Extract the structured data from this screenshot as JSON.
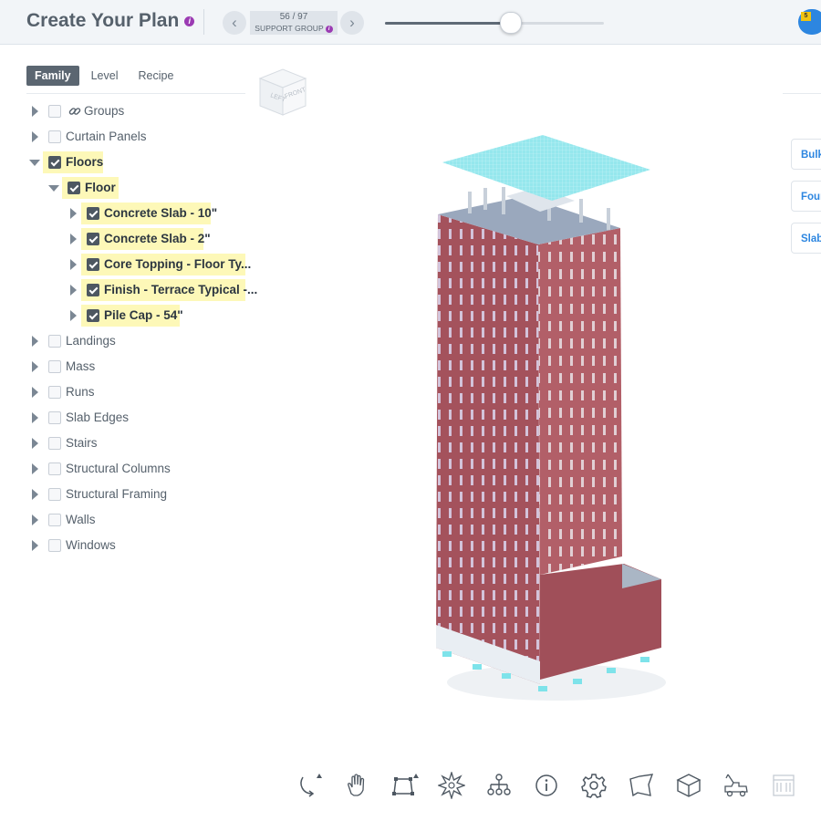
{
  "header": {
    "title": "Create Your Plan",
    "info_glyph": "i",
    "prev_glyph": "‹",
    "next_glyph": "›",
    "counter": "56 / 97",
    "group_label": "SUPPORT GROUP",
    "slider_percent": 57,
    "notification_count": "5"
  },
  "tabs": [
    {
      "label": "Family",
      "active": true
    },
    {
      "label": "Level",
      "active": false
    },
    {
      "label": "Recipe",
      "active": false
    }
  ],
  "tree": [
    {
      "label": "Groups"
    },
    {
      "label": "Curtain Panels"
    },
    {
      "label": "Floors"
    },
    {
      "label": "Floor"
    },
    {
      "label": "Concrete Slab - 10\""
    },
    {
      "label": "Concrete Slab - 2\""
    },
    {
      "label": "Core Topping - Floor Ty..."
    },
    {
      "label": "Finish - Terrace Typical -..."
    },
    {
      "label": "Pile Cap - 54\""
    },
    {
      "label": "Landings"
    },
    {
      "label": "Mass"
    },
    {
      "label": "Runs"
    },
    {
      "label": "Slab Edges"
    },
    {
      "label": "Stairs"
    },
    {
      "label": "Structural Columns"
    },
    {
      "label": "Structural Framing"
    },
    {
      "label": "Walls"
    },
    {
      "label": "Windows"
    }
  ],
  "viewcube": {
    "left": "LEFT",
    "front": "FRONT"
  },
  "side_buttons": [
    {
      "label": "Bulk"
    },
    {
      "label": "Foun"
    },
    {
      "label": "Slab"
    }
  ],
  "toolbar_icons": [
    "orbit-icon",
    "pan-hand-icon",
    "fit-view-icon",
    "explode-icon",
    "model-tree-icon",
    "info-icon",
    "settings-icon",
    "map-icon",
    "box-3d-icon",
    "crane-truck-icon",
    "storefront-icon"
  ],
  "colors": {
    "accent": "#2d86e0",
    "highlight": "#fdf8b8",
    "active_tab": "#5b6671",
    "building_facade": "#a4525c",
    "roof_selection": "#7ee3ea"
  }
}
